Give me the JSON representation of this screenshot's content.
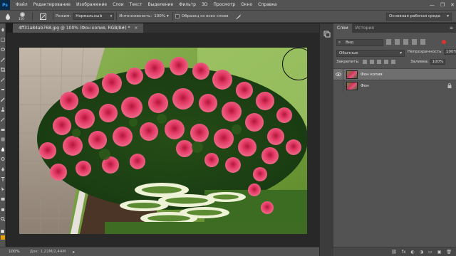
{
  "app": {
    "logo": "Ps"
  },
  "menubar": {
    "items": [
      "Файл",
      "Редактирование",
      "Изображение",
      "Слои",
      "Текст",
      "Выделение",
      "Фильтр",
      "3D",
      "Просмотр",
      "Окно",
      "Справка"
    ],
    "window_controls": {
      "minimize": "—",
      "maximize": "❐",
      "close": "✕"
    }
  },
  "options": {
    "brush_size": "150",
    "mode_label": "Режим:",
    "mode_value": "Нормальный",
    "intensity_label": "Интенсивность:",
    "intensity_value": "100%",
    "sample_all_label": "Образец со всех слоев",
    "workspace": "Основная рабочая среда"
  },
  "document": {
    "tab_title": "4ff31a84ab768.jpg @ 100% (Фон копия, RGB/8#) *",
    "close_glyph": "×",
    "zoom": "100%",
    "doc_info": "Док: 1,22M/2,44M",
    "status_arrow": "▸"
  },
  "layers_panel": {
    "tabs": [
      "Слои",
      "История"
    ],
    "menu_glyph": "≡",
    "filter_label": "Вид",
    "blend_mode": "Обычные",
    "opacity_label": "Непрозрачность:",
    "opacity_value": "100%",
    "lock_label": "Закрепить:",
    "fill_label": "Заливка:",
    "fill_value": "100%",
    "layers": [
      {
        "name": "Фон копия",
        "visible": true,
        "selected": true
      },
      {
        "name": "Фон",
        "visible": false,
        "selected": false
      }
    ],
    "bottom_icons": [
      "⛓",
      "fx",
      "◐",
      "◑",
      "▭",
      "▣",
      "🗑"
    ]
  },
  "colors": {
    "menubar_bg": "#535353",
    "canvas_bg": "#282828",
    "selected_layer": "#6f6f6f"
  }
}
